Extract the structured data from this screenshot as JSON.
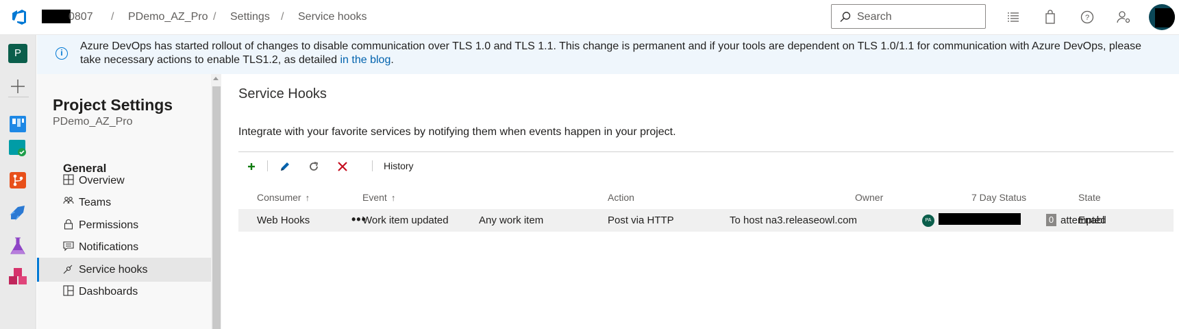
{
  "topbar": {
    "org_suffix": "0807",
    "breadcrumb": [
      "PDemo_AZ_Pro",
      "Settings",
      "Service hooks"
    ],
    "breadcrumb_sep": "/",
    "search_placeholder": "Search",
    "icons": [
      "azure-devops-logo-icon",
      "list-icon",
      "shopping-bag-icon",
      "help-icon",
      "user-settings-icon"
    ]
  },
  "leftnav": {
    "project_initial": "P",
    "icons": [
      "add-icon",
      "boards-icon",
      "test-plans-icon",
      "repos-icon",
      "pipelines-icon",
      "test-icon",
      "artifacts-icon"
    ]
  },
  "banner": {
    "text": "Azure DevOps has started rollout of changes to disable communication over TLS 1.0 and TLS 1.1. This change is permanent and if your tools are dependent on TLS 1.0/1.1 for communication with Azure DevOps, please take necessary actions to enable TLS1.2, as detailed ",
    "link_text": "in the blog",
    "trailing": ".",
    "close_glyph": "✕"
  },
  "sidebar": {
    "title": "Project Settings",
    "subtitle": "PDemo_AZ_Pro",
    "section": "General",
    "items": [
      {
        "label": "Overview",
        "icon": "overview-icon"
      },
      {
        "label": "Teams",
        "icon": "teams-icon"
      },
      {
        "label": "Permissions",
        "icon": "lock-icon"
      },
      {
        "label": "Notifications",
        "icon": "notifications-icon"
      },
      {
        "label": "Service hooks",
        "icon": "service-hooks-icon",
        "active": true
      },
      {
        "label": "Dashboards",
        "icon": "dashboards-icon"
      }
    ]
  },
  "main": {
    "title": "Service Hooks",
    "description": "Integrate with your favorite services by notifying them when events happen in your project.",
    "toolbar": {
      "add_icon": "add-icon",
      "edit_icon": "edit-icon",
      "refresh_icon": "refresh-icon",
      "delete_icon": "delete-icon",
      "history_label": "History"
    },
    "table": {
      "headers": {
        "consumer": "Consumer",
        "event": "Event",
        "action": "Action",
        "owner": "Owner",
        "status": "7 Day Status",
        "state": "State",
        "sort_glyph": "↑"
      },
      "row": {
        "consumer": "Web Hooks",
        "more": "•••",
        "event": "Work item updated",
        "event_filter": "Any work item",
        "action": "Post via HTTP",
        "action_target": "To host na3.releaseowl.com",
        "owner_initials": "PA",
        "status_count": "0",
        "status_text": "attempted",
        "state": "Enabl"
      }
    }
  },
  "colors": {
    "accent": "#0078d4",
    "banner_bg": "#eff6fc",
    "project_badge": "#0b5e4b"
  }
}
